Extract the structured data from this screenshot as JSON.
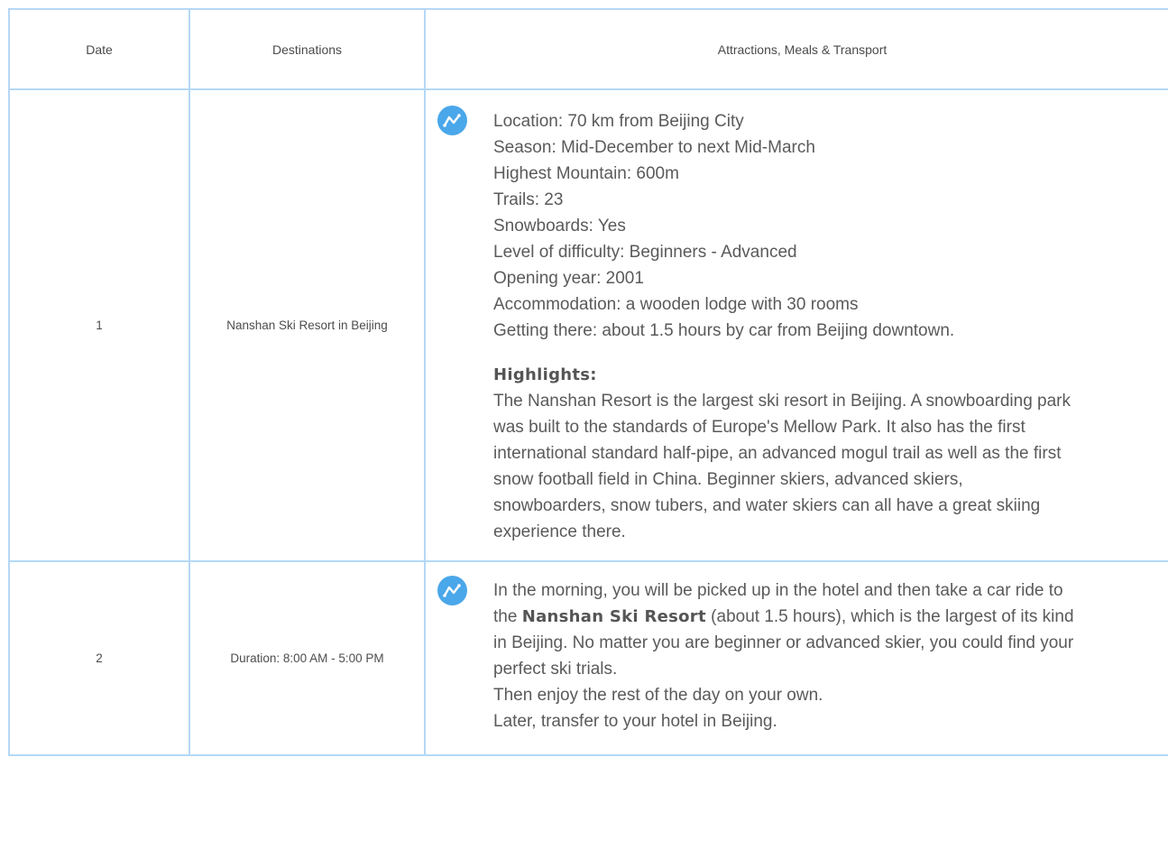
{
  "table": {
    "headers": {
      "date": "Date",
      "destinations": "Destinations",
      "details": "Attractions, Meals & Transport"
    },
    "rows": [
      {
        "date": "1",
        "destination": "Nanshan Ski Resort in Beijing",
        "icon": "trend-line-icon",
        "facts": [
          "Location: 70 km from Beijing City",
          "Season: Mid-December to next Mid-March",
          "Highest Mountain: 600m",
          "Trails: 23",
          "Snowboards: Yes",
          "Level of difficulty: Beginners - Advanced",
          "Opening year: 2001",
          "Accommodation: a wooden lodge with 30 rooms",
          "Getting there: about 1.5 hours by car from Beijing downtown."
        ],
        "highlights_heading": "Highlights:",
        "highlights_text": "The Nanshan Resort is the largest ski resort in Beijing. A snowboarding park was built to the standards of Europe's Mellow Park. It also has the first international standard half-pipe, an advanced mogul trail as well as the first snow football field in China. Beginner skiers, advanced skiers, snowboarders, snow tubers, and water skiers can all have a great skiing experience there."
      },
      {
        "date": "2",
        "destination": "Duration: 8:00 AM - 5:00 PM",
        "icon": "trend-line-icon",
        "intro_before": "In the morning, you will be picked up in the hotel and then take a car ride to the ",
        "intro_bold": "Nanshan Ski Resort",
        "intro_after": " (about 1.5 hours), which is the largest of its kind in Beijing. No matter you are beginner or advanced skier, you could find your perfect ski trials.",
        "line_2": "Then enjoy the rest of the day on your own.",
        "line_3": "Later, transfer to your hotel in Beijing."
      }
    ]
  },
  "colors": {
    "border": "#b5d8f5",
    "icon_bg": "#4aa7ea",
    "text": "#5a5a5a"
  }
}
